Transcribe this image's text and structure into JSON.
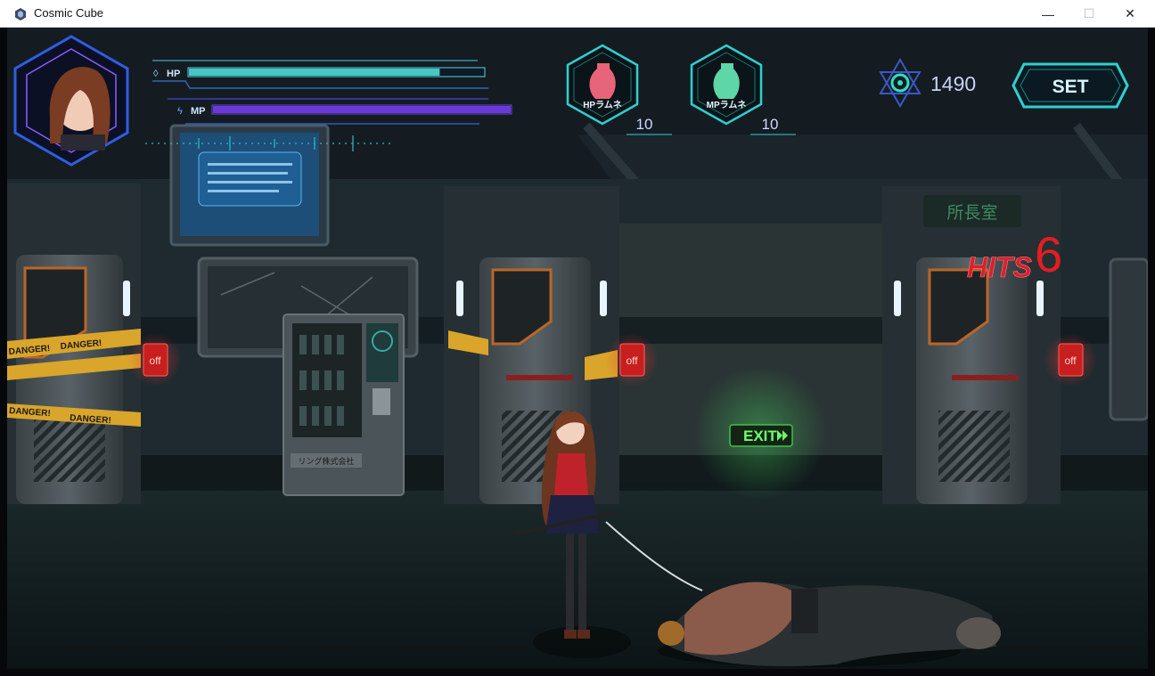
{
  "window": {
    "title": "Cosmic Cube",
    "controls": {
      "minimize": "—",
      "maximize": "☐",
      "close": "✕"
    }
  },
  "hud": {
    "hp": {
      "label": "HP",
      "fraction": 0.85,
      "color": "#43c8c4"
    },
    "mp": {
      "label": "MP",
      "fraction": 1.0,
      "color": "#6a3ad6"
    },
    "items": [
      {
        "name": "HPラムネ",
        "count": "10",
        "bottle_color": "#e8647a"
      },
      {
        "name": "MPラムネ",
        "count": "10",
        "bottle_color": "#5fd6a8"
      }
    ],
    "score": "1490",
    "settings_label": "SET",
    "accent_color": "#2fd0d0"
  },
  "scene": {
    "sign_room": "所長室",
    "exit_label": "EXIT",
    "switch_labels": [
      "off",
      "off",
      "off"
    ],
    "danger_tape": "DANGER!",
    "vending_label": "リング株式会社",
    "combo": {
      "label": "HITS",
      "count": "6"
    }
  }
}
